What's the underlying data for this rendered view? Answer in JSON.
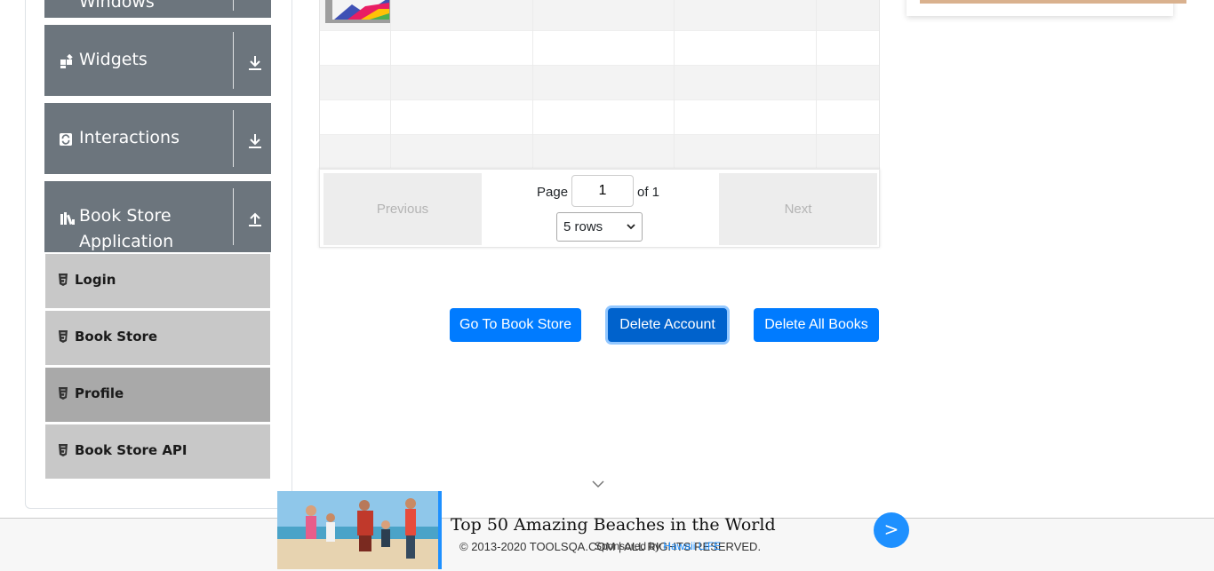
{
  "sidebar": {
    "groups": [
      {
        "label": "Windows"
      },
      {
        "label": "Widgets"
      },
      {
        "label": "Interactions"
      },
      {
        "label": "Book Store Application",
        "line1": "Book Store",
        "line2": "Application"
      }
    ],
    "items": [
      {
        "label": "Login"
      },
      {
        "label": "Book Store"
      },
      {
        "label": "Profile",
        "active": true
      },
      {
        "label": "Book Store API"
      }
    ]
  },
  "table": {
    "pagination": {
      "previous_label": "Previous",
      "next_label": "Next",
      "page_label": "Page",
      "page_value": "1",
      "of_label": "of 1",
      "rows_option": "5 rows"
    }
  },
  "actions": {
    "go_to_store_label": "Go To Book Store",
    "delete_account_label": "Delete Account",
    "delete_all_books_label": "Delete All Books"
  },
  "footer": {
    "copyright": "© 2013-2020 TOOLSQA.COM | ALL RIGHTS RESERVED."
  },
  "ad": {
    "title": "Top 50 Amazing Beaches in the World",
    "sponsored_prefix": "Sponsored by",
    "sponsor_name": "Hawaii LIFE",
    "go_label": ">"
  },
  "colors": {
    "sidebar_group": "#6c757d",
    "sidebar_item": "#c8c8c8",
    "sidebar_item_active": "#a9a9a9",
    "primary": "#007bff",
    "ad_accent": "#1e90ff"
  }
}
